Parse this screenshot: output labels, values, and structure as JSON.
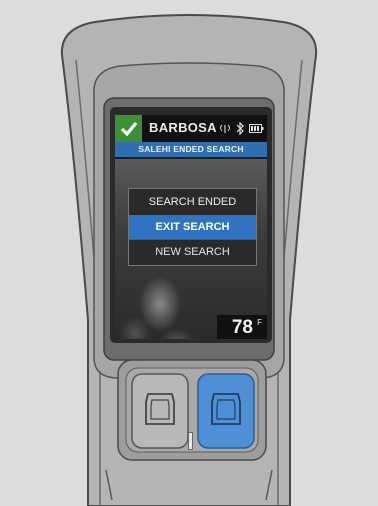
{
  "status_bar": {
    "name": "BARBOSA",
    "check_icon": "checkmark-icon",
    "signal_icon": "signal-icon",
    "bluetooth_icon": "bluetooth-icon",
    "battery_icon": "battery-icon",
    "check_color": "#3d8f38"
  },
  "banner": {
    "text": "SALEHI ENDED SEARCH",
    "color": "#2f6fb0"
  },
  "menu": {
    "title": "SEARCH ENDED",
    "items": [
      {
        "label": "EXIT SEARCH",
        "selected": true
      },
      {
        "label": "NEW SEARCH",
        "selected": false
      }
    ],
    "accent_color": "#2f73c2"
  },
  "temperature": {
    "value": "78",
    "unit": "F"
  },
  "hardware_buttons": {
    "right_button_color": "#4f8fd6"
  }
}
